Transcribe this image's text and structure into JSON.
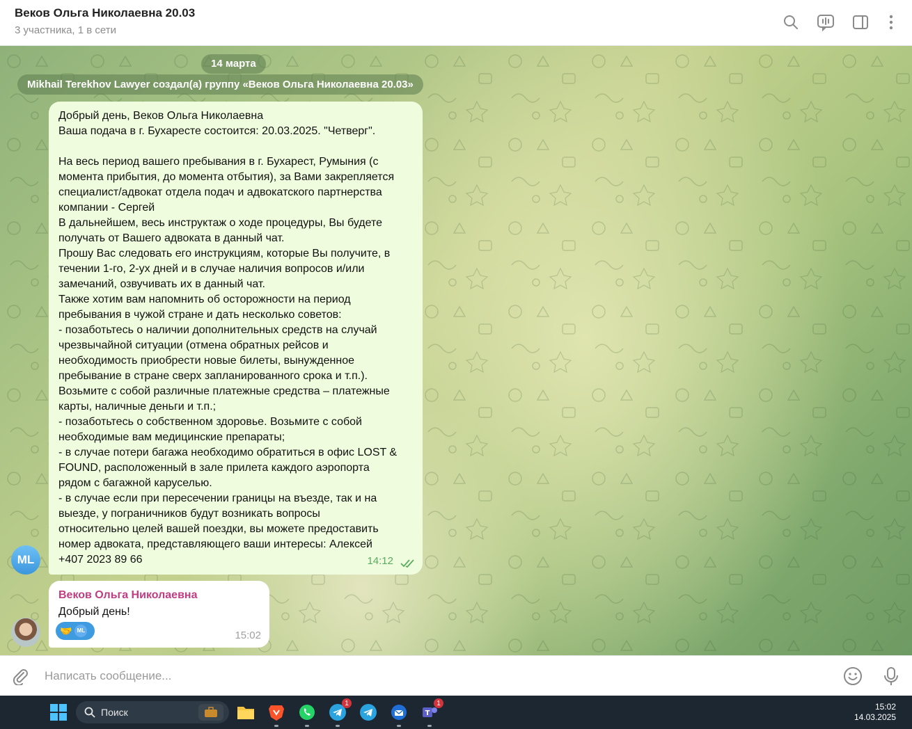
{
  "header": {
    "title": "Веков Ольга Николаевна 20.03",
    "subtitle": "3 участника, 1 в сети"
  },
  "chat": {
    "date_label": "14 марта",
    "service_message": "Mikhail Terekhov Lawyer создал(а) группу «Веков Ольга Николаевна 20.03»",
    "outgoing": {
      "lines": [
        "Добрый день, Веков Ольга Николаевна",
        "Ваша подача в г. Бухаресте состоится: 20.03.2025. \"Четверг\".",
        "",
        "На весь период вашего пребывания в г. Бухарест, Румыния (с",
        "момента прибытия, до момента отбытия), за Вами закрепляется",
        "специалист/адвокат отдела подач и адвокатского партнерства",
        "компании - Сергей",
        "В дальнейшем, весь инструктаж о ходе процедуры, Вы будете",
        "получать от Вашего адвоката в данный чат.",
        "Прошу Вас следовать его инструкциям, которые Вы получите, в",
        "течении 1-го, 2-ух дней и в случае наличия вопросов и/или",
        "замечаний, озвучивать их в данный чат.",
        "Также хотим вам напомнить об осторожности на период",
        "пребывания в чужой стране и дать несколько советов:",
        "- позаботьтесь о наличии дополнительных средств на случай",
        "чрезвычайной ситуации (отмена обратных рейсов и",
        "необходимость приобрести новые билеты, вынужденное",
        "пребывание в стране сверх запланированного срока и т.п.).",
        "Возьмите с собой различные платежные средства – платежные",
        "карты, наличные деньги и т.п.;",
        "- позаботьтесь о собственном здоровье. Возьмите с собой",
        "необходимые вам медицинские препараты;",
        "- в случае потери багажа необходимо обратиться в офис LOST &",
        "FOUND, расположенный в зале прилета каждого аэропорта",
        "рядом с багажной каруселью.",
        "- в случае если при пересечении границы на въезде, так и на",
        "выезде, у пограничников будут возникать вопросы",
        "относительно целей вашей поездки, вы можете предоставить",
        "номер адвоката, представляющего ваши интересы: Алексей",
        "+407 2023 89 66"
      ],
      "time": "14:12",
      "sender_avatar_initials": "ML"
    },
    "incoming": {
      "author": "Веков Ольга Николаевна",
      "text": "Добрый день!",
      "time": "15:02",
      "reaction_emoji": "🤝",
      "reaction_avatar_initials": "ML"
    }
  },
  "composer": {
    "placeholder": "Написать сообщение..."
  },
  "taskbar": {
    "search_label": "Поиск",
    "telegram_badge": "1",
    "teams_badge": "1",
    "time": "15:02",
    "date": "14.03.2025"
  }
}
